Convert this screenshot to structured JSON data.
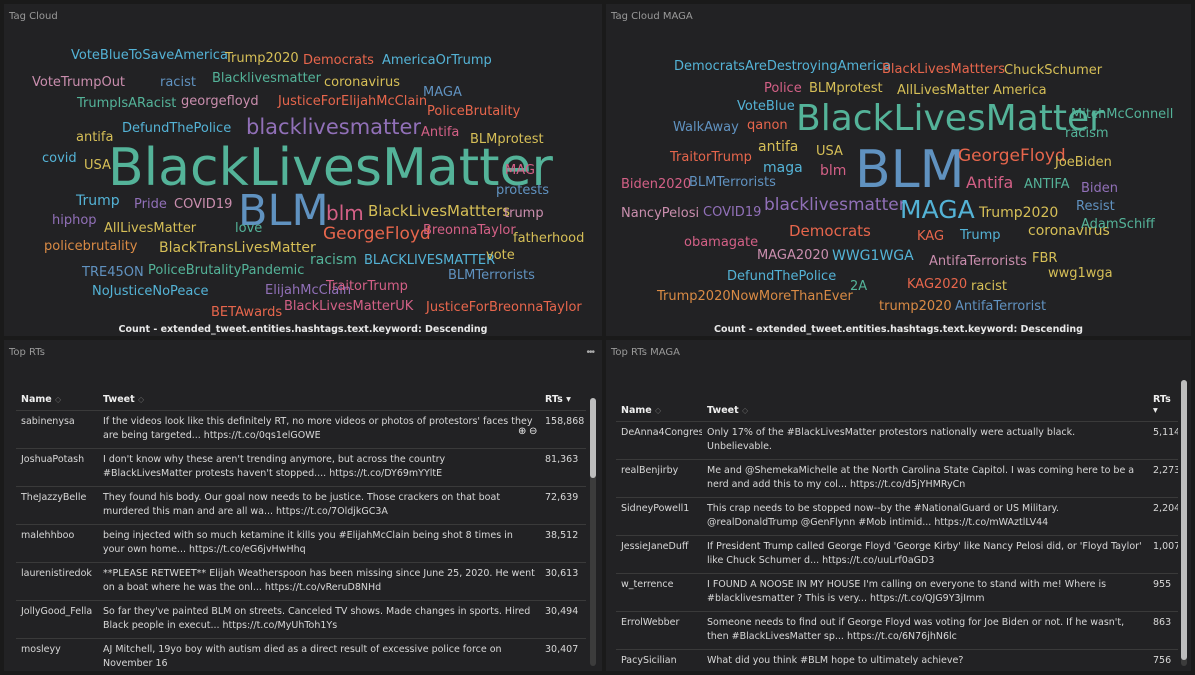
{
  "panels": {
    "tag_cloud": {
      "title": "Tag Cloud",
      "caption": "Count - extended_tweet.entities.hashtags.text.keyword: Descending",
      "words": [
        {
          "t": "VoteBlueToSaveAmerica",
          "c": "#54b3d6"
        },
        {
          "t": "Trump2020",
          "c": "#d6bf57"
        },
        {
          "t": "Democrats",
          "c": "#e7664c"
        },
        {
          "t": "AmericaOrTrump",
          "c": "#54b3d6"
        },
        {
          "t": "VoteTrumpOut",
          "c": "#ca8eae"
        },
        {
          "t": "racist",
          "c": "#6092c0"
        },
        {
          "t": "Blacklivesmatter",
          "c": "#54b399"
        },
        {
          "t": "coronavirus",
          "c": "#d6bf57"
        },
        {
          "t": "TrumpIsARacist",
          "c": "#54b399"
        },
        {
          "t": "georgefloyd",
          "c": "#ca8eae"
        },
        {
          "t": "JusticeForElijahMcClain",
          "c": "#e7664c"
        },
        {
          "t": "MAGA",
          "c": "#6092c0"
        },
        {
          "t": "PoliceBrutality",
          "c": "#e7664c"
        },
        {
          "t": "antifa",
          "c": "#d6bf57"
        },
        {
          "t": "DefundThePolice",
          "c": "#54b3d6"
        },
        {
          "t": "blacklivesmatter",
          "c": "#9170b8"
        },
        {
          "t": "Antifa",
          "c": "#d36086"
        },
        {
          "t": "BLMprotest",
          "c": "#d6bf57"
        },
        {
          "t": "covid",
          "c": "#54b3d6"
        },
        {
          "t": "USA",
          "c": "#d6bf57"
        },
        {
          "t": "BlackLivesMatter",
          "c": "#54b399"
        },
        {
          "t": "MAG",
          "c": "#d36086"
        },
        {
          "t": "protests",
          "c": "#6092c0"
        },
        {
          "t": "Trump",
          "c": "#54b3d6"
        },
        {
          "t": "Pride",
          "c": "#9170b8"
        },
        {
          "t": "COVID19",
          "c": "#ca8eae"
        },
        {
          "t": "BLM",
          "c": "#6092c0"
        },
        {
          "t": "blm",
          "c": "#d36086"
        },
        {
          "t": "BlackLivesMattters",
          "c": "#d6bf57"
        },
        {
          "t": "trump",
          "c": "#ca8eae"
        },
        {
          "t": "hiphop",
          "c": "#9170b8"
        },
        {
          "t": "AllLivesMatter",
          "c": "#d6bf57"
        },
        {
          "t": "love",
          "c": "#54b399"
        },
        {
          "t": "GeorgeFloyd",
          "c": "#e7664c"
        },
        {
          "t": "BreonnaTaylor",
          "c": "#d36086"
        },
        {
          "t": "fatherhood",
          "c": "#d6bf57"
        },
        {
          "t": "policebrutality",
          "c": "#da8b45"
        },
        {
          "t": "BlackTransLivesMatter",
          "c": "#d6bf57"
        },
        {
          "t": "racism",
          "c": "#54b399"
        },
        {
          "t": "BLACKLIVESMATTER",
          "c": "#54b3d6"
        },
        {
          "t": "vote",
          "c": "#d6bf57"
        },
        {
          "t": "TRE45ON",
          "c": "#6092c0"
        },
        {
          "t": "PoliceBrutalityPandemic",
          "c": "#54b399"
        },
        {
          "t": "BLMTerrorists",
          "c": "#6092c0"
        },
        {
          "t": "NoJusticeNoPeace",
          "c": "#54b3d6"
        },
        {
          "t": "ElijahMcClain",
          "c": "#9170b8"
        },
        {
          "t": "TraitorTrump",
          "c": "#d36086"
        },
        {
          "t": "BETAwards",
          "c": "#e7664c"
        },
        {
          "t": "BlackLivesMatterUK",
          "c": "#d36086"
        },
        {
          "t": "JusticeForBreonnaTaylor",
          "c": "#e7664c"
        }
      ]
    },
    "tag_cloud_maga": {
      "title": "Tag Cloud MAGA",
      "caption": "Count - extended_tweet.entities.hashtags.text.keyword: Descending",
      "words": [
        {
          "t": "DemocratsAreDestroyingAmerica",
          "c": "#54b3d6"
        },
        {
          "t": "BlackLivesMattters",
          "c": "#e7664c"
        },
        {
          "t": "ChuckSchumer",
          "c": "#d6bf57"
        },
        {
          "t": "Police",
          "c": "#d36086"
        },
        {
          "t": "BLMprotest",
          "c": "#d6bf57"
        },
        {
          "t": "AllLivesMatter",
          "c": "#d6bf57"
        },
        {
          "t": "America",
          "c": "#d6bf57"
        },
        {
          "t": "VoteBlue",
          "c": "#54b3d6"
        },
        {
          "t": "WalkAway",
          "c": "#6092c0"
        },
        {
          "t": "qanon",
          "c": "#e7664c"
        },
        {
          "t": "BlackLivesMatter",
          "c": "#54b399"
        },
        {
          "t": "MitchMcConnell",
          "c": "#54b399"
        },
        {
          "t": "racism",
          "c": "#54b399"
        },
        {
          "t": "antifa",
          "c": "#d6bf57"
        },
        {
          "t": "USA",
          "c": "#d6bf57"
        },
        {
          "t": "TraitorTrump",
          "c": "#e7664c"
        },
        {
          "t": "maga",
          "c": "#54b3d6"
        },
        {
          "t": "blm",
          "c": "#d36086"
        },
        {
          "t": "BLM",
          "c": "#6092c0"
        },
        {
          "t": "GeorgeFloyd",
          "c": "#e7664c"
        },
        {
          "t": "JoeBiden",
          "c": "#d6bf57"
        },
        {
          "t": "Biden2020",
          "c": "#d36086"
        },
        {
          "t": "BLMTerrorists",
          "c": "#6092c0"
        },
        {
          "t": "Antifa",
          "c": "#d36086"
        },
        {
          "t": "ANTIFA",
          "c": "#54b399"
        },
        {
          "t": "Biden",
          "c": "#9170b8"
        },
        {
          "t": "NancyPelosi",
          "c": "#ca8eae"
        },
        {
          "t": "COVID19",
          "c": "#9170b8"
        },
        {
          "t": "blacklivesmatter",
          "c": "#9170b8"
        },
        {
          "t": "MAGA",
          "c": "#54b3d6"
        },
        {
          "t": "Trump2020",
          "c": "#d6bf57"
        },
        {
          "t": "Resist",
          "c": "#6092c0"
        },
        {
          "t": "Democrats",
          "c": "#e7664c"
        },
        {
          "t": "KAG",
          "c": "#e7664c"
        },
        {
          "t": "Trump",
          "c": "#54b3d6"
        },
        {
          "t": "coronavirus",
          "c": "#d6bf57"
        },
        {
          "t": "AdamSchiff",
          "c": "#54b399"
        },
        {
          "t": "obamagate",
          "c": "#d36086"
        },
        {
          "t": "MAGA2020",
          "c": "#ca8eae"
        },
        {
          "t": "WWG1WGA",
          "c": "#54b3d6"
        },
        {
          "t": "AntifaTerrorists",
          "c": "#ca8eae"
        },
        {
          "t": "FBR",
          "c": "#d6bf57"
        },
        {
          "t": "wwg1wga",
          "c": "#d6bf57"
        },
        {
          "t": "DefundThePolice",
          "c": "#54b3d6"
        },
        {
          "t": "KAG2020",
          "c": "#e7664c"
        },
        {
          "t": "racist",
          "c": "#d6bf57"
        },
        {
          "t": "Trump2020NowMoreThanEver",
          "c": "#da8b45"
        },
        {
          "t": "2A",
          "c": "#54b399"
        },
        {
          "t": "trump2020",
          "c": "#da8b45"
        },
        {
          "t": "AntifaTerrorist",
          "c": "#6092c0"
        }
      ]
    },
    "top_rts": {
      "title": "Top RTs",
      "menu_icon": "ellipsis-icon",
      "columns": {
        "name": "Name",
        "tweet": "Tweet",
        "rts": "RTs"
      },
      "sort_neutral": "◇",
      "sort_desc": "▾",
      "rows": [
        {
          "name": "sabinenysa",
          "tweet": "If the videos look like this definitely RT, no more videos or photos of protestors' faces they are being targeted... https://t.co/0qs1elGOWE",
          "rts": "158,868"
        },
        {
          "name": "JoshuaPotash",
          "tweet": "I don't know why these aren't trending anymore, but across the country #BlackLivesMatter protests haven't stopped.... https://t.co/DY69mYYltE",
          "rts": "81,363"
        },
        {
          "name": "TheJazzyBelle",
          "tweet": "They found his body. Our goal now needs to be justice. Those crackers on that boat murdered this man and are all wa... https://t.co/7OldjkGC3A",
          "rts": "72,639"
        },
        {
          "name": "malehhboo",
          "tweet": "being injected with so much ketamine it kills you #ElijahMcClain being shot 8 times in your own home... https://t.co/eG6jvHwHhq",
          "rts": "38,512"
        },
        {
          "name": "laurenistiredok",
          "tweet": "**PLEASE RETWEET** Elijah Weatherspoon has been missing since June 25, 2020. He went on a boat where he was the onl... https://t.co/vReruD8NHd",
          "rts": "30,613"
        },
        {
          "name": "JollyGood_Fella",
          "tweet": "So far they've painted BLM on streets. Canceled TV shows. Made changes in sports. Hired Black people in execut... https://t.co/MyUhToh1Ys",
          "rts": "30,494"
        },
        {
          "name": "mosleyy",
          "tweet": "AJ Mitchell, 19yo boy with autism died as a direct result of excessive police force on November 16",
          "rts": "30,407"
        }
      ]
    },
    "top_rts_maga": {
      "title": "Top RTs MAGA",
      "columns": {
        "name": "Name",
        "tweet": "Tweet",
        "rts": "RTs"
      },
      "sort_neutral": "◇",
      "sort_desc": "▾",
      "rows": [
        {
          "name": "DeAnna4Congress",
          "tweet": "Only 17% of the #BlackLivesMatter protestors nationally were actually black. Unbelievable.",
          "rts": "5,114"
        },
        {
          "name": "realBenjirby",
          "tweet": "Me and @ShemekaMichelle at the North Carolina State Capitol. I was coming here to be a nerd and add this to my col... https://t.co/d5jYHMRyCn",
          "rts": "2,273"
        },
        {
          "name": "SidneyPowell1",
          "tweet": "This crap needs to be stopped now--by the #NationalGuard or US Military. @realDonaldTrump @GenFlynn #Mob intimid... https://t.co/mWAztlLV44",
          "rts": "2,204"
        },
        {
          "name": "JessieJaneDuff",
          "tweet": "If President Trump called George Floyd 'George Kirby' like Nancy Pelosi did, or 'Floyd Taylor' like Chuck Schumer d... https://t.co/uuLrf0aGD3",
          "rts": "1,007"
        },
        {
          "name": "w_terrence",
          "tweet": "I FOUND A NOOSE IN MY HOUSE I'm calling on everyone to stand with me! Where is #blacklivesmatter ? This is very... https://t.co/QJG9Y3jImm",
          "rts": "955"
        },
        {
          "name": "ErrolWebber",
          "tweet": "Someone needs to find out if George Floyd was voting for Joe Biden or not. If he wasn't, then #BlackLivesMatter sp... https://t.co/6N76jhN6lc",
          "rts": "863"
        },
        {
          "name": "PacySicilian",
          "tweet": "What did you think #BLM hope to ultimately achieve?",
          "rts": "756"
        }
      ]
    }
  }
}
